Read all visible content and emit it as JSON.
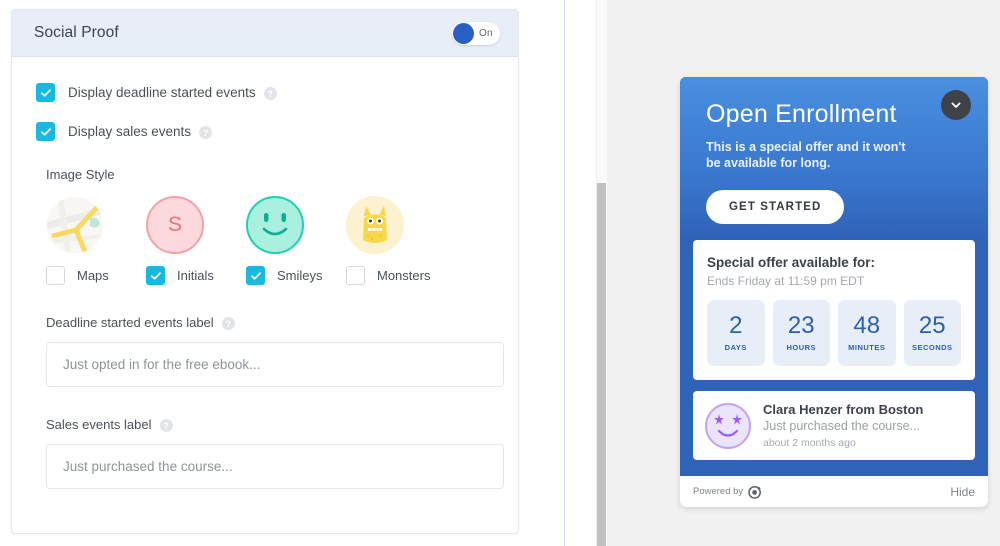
{
  "editor": {
    "panel_title": "Social Proof",
    "toggle": {
      "state_label": "On",
      "on": true,
      "accent": "#2b5fc4"
    },
    "checkboxes": [
      {
        "label": "Display deadline started events",
        "checked": true,
        "help": "?"
      },
      {
        "label": "Display sales events",
        "checked": true,
        "help": "?"
      }
    ],
    "image_style": {
      "section_label": "Image Style",
      "options": [
        {
          "name": "Maps",
          "checked": false,
          "icon": "map-thumbnail-icon"
        },
        {
          "name": "Initials",
          "checked": true,
          "icon": "initials-avatar-icon",
          "initial": "S"
        },
        {
          "name": "Smileys",
          "checked": true,
          "icon": "smiley-avatar-icon"
        },
        {
          "name": "Monsters",
          "checked": false,
          "icon": "monster-avatar-icon"
        }
      ]
    },
    "fields": [
      {
        "label": "Deadline started events label",
        "help": "?",
        "value": "Just opted in for the free ebook...",
        "placeholder": "Just opted in for the free ebook..."
      },
      {
        "label": "Sales events label",
        "help": "?",
        "value": "Just purchased the course...",
        "placeholder": "Just purchased the course..."
      }
    ]
  },
  "preview": {
    "hero": {
      "title": "Open Enrollment",
      "subtitle": "This is a special offer and it won't be available for long.",
      "cta_label": "GET STARTED",
      "collapse_icon": "chevron-down-icon",
      "accent": "#3a7ad0"
    },
    "countdown": {
      "title": "Special offer available for:",
      "subtitle": "Ends Friday at 11:59 pm EDT",
      "units": [
        {
          "value": "2",
          "unit": "DAYS"
        },
        {
          "value": "23",
          "unit": "HOURS"
        },
        {
          "value": "48",
          "unit": "MINUTES"
        },
        {
          "value": "25",
          "unit": "SECONDS"
        }
      ],
      "number_color": "#2c5fae",
      "box_color": "#e7eef8"
    },
    "social_proof": {
      "avatar_icon": "star-eyes-smiley-avatar",
      "name": "Clara Henzer from Boston",
      "action": "Just purchased the course...",
      "time": "about 2 months ago"
    },
    "footer": {
      "powered_by": "Powered by",
      "brand_icon": "deadline-funnel-logo-icon",
      "hide_label": "Hide"
    }
  }
}
